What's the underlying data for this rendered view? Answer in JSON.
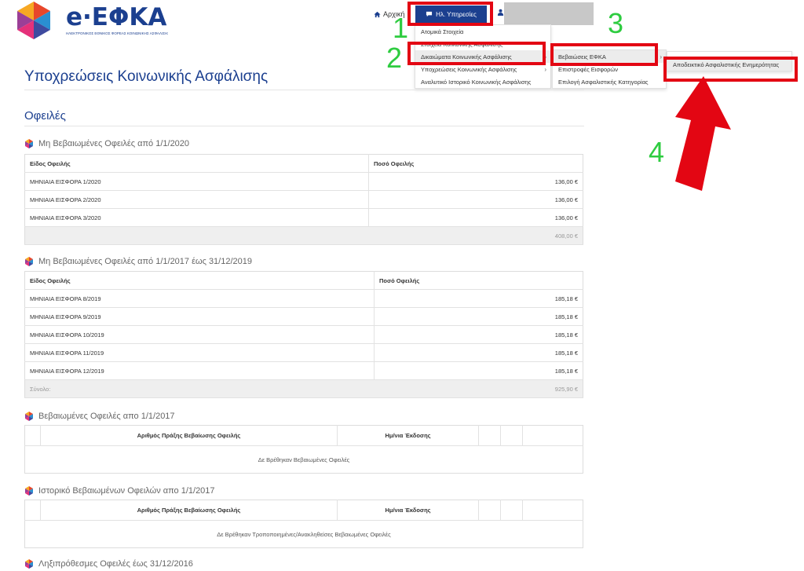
{
  "brand": {
    "logo_text": "e·ΕΦΚΑ",
    "logo_subtitle": "ΗΛΕΚΤΡΟΝΙΚΟΣ ΕΘΝΙΚΟΣ ΦΟΡΕΑΣ ΚΟΙΝΩΝΙΚΗΣ ΑΣΦΑΛΙΣΗΣ"
  },
  "nav": {
    "home": "Αρχική",
    "services": "Ηλ. Υπηρεσίες"
  },
  "menu1": [
    "Ατομικά Στοιχεία",
    "Στοιχεία Κοινωνικής Ασφάλισης",
    "Δικαιώματα Κοινωνικής Ασφάλισης",
    "Υποχρεώσεις Κοινωνικής Ασφάλισης",
    "Αναλυτικό Ιστορικό Κοινωνικής Ασφάλισης"
  ],
  "menu2": [
    "Βεβαιώσεις ΕΦΚΑ",
    "Επιστροφές Εισφορών",
    "Επιλογή Ασφαλιστικής Κατηγορίας"
  ],
  "menu3": [
    "Αποδεικτικό Ασφαλιστικής Ενημερότητας"
  ],
  "steps": [
    "1",
    "2",
    "3",
    "4"
  ],
  "page_title": "Υποχρεώσεις Κοινωνικής Ασφάλισης",
  "section_title": "Οφειλές",
  "table1": {
    "title": "Μη Βεβαιωμένες Οφειλές από 1/1/2020",
    "headers": [
      "Είδος Οφειλής",
      "Ποσό Οφειλής"
    ],
    "rows": [
      [
        "ΜΗΝΙΑΙΑ ΕΙΣΦΟΡΑ 1/2020",
        "136,00 €"
      ],
      [
        "ΜΗΝΙΑΙΑ ΕΙΣΦΟΡΑ 2/2020",
        "136,00 €"
      ],
      [
        "ΜΗΝΙΑΙΑ ΕΙΣΦΟΡΑ 3/2020",
        "136,00 €"
      ]
    ],
    "total": "408,00 €"
  },
  "table2": {
    "title": "Μη Βεβαιωμένες Οφειλές από 1/1/2017 έως 31/12/2019",
    "headers": [
      "Είδος Οφειλής",
      "Ποσό Οφειλής"
    ],
    "rows": [
      [
        "ΜΗΝΙΑΙΑ ΕΙΣΦΟΡΑ 8/2019",
        "185,18 €"
      ],
      [
        "ΜΗΝΙΑΙΑ ΕΙΣΦΟΡΑ 9/2019",
        "185,18 €"
      ],
      [
        "ΜΗΝΙΑΙΑ ΕΙΣΦΟΡΑ 10/2019",
        "185,18 €"
      ],
      [
        "ΜΗΝΙΑΙΑ ΕΙΣΦΟΡΑ 11/2019",
        "185,18 €"
      ],
      [
        "ΜΗΝΙΑΙΑ ΕΙΣΦΟΡΑ 12/2019",
        "185,18 €"
      ]
    ],
    "total_label": "Σύνολο:",
    "total": "925,90 €"
  },
  "table3": {
    "title": "Βεβαιωμένες Οφειλές απο 1/1/2017",
    "headers": [
      "Αριθμός Πράξης Βεβαίωσης Οφειλής",
      "Ημ/νια Έκδοσης"
    ],
    "empty": "Δε Βρέθηκαν Βεβαιωμένες Οφειλές"
  },
  "table4": {
    "title": "Ιστορικό Βεβαιωμένων Οφειλών απο 1/1/2017",
    "headers": [
      "Αριθμός Πράξης Βεβαίωσης Οφειλής",
      "Ημ/νια Έκδοσης"
    ],
    "empty": "Δε Βρέθηκαν Τροποποιημένες/Ανακληθείσες Βεβαιωμένες Οφειλές"
  },
  "section5_title": "Ληξιπρόθεσμες Οφειλές έως 31/12/2016"
}
